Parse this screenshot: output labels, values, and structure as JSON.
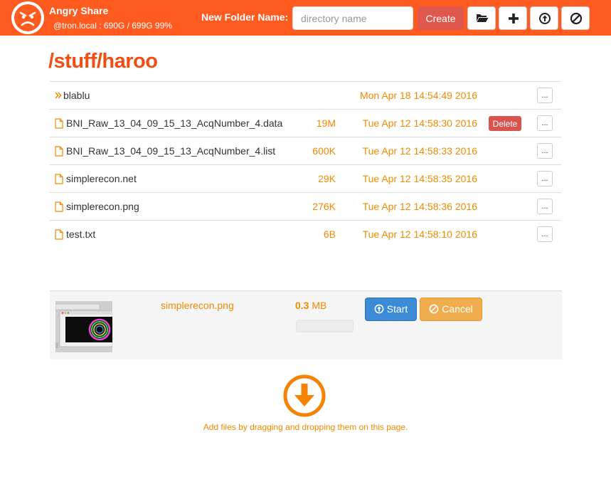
{
  "header": {
    "app_title": "Angry Share",
    "host_info": "@tron.local : 690G / 699G 99%",
    "folder_label": "New Folder Name:",
    "folder_placeholder": "directory name",
    "create_label": "Create",
    "icon_buttons": [
      "open-folder-icon",
      "plus-icon",
      "upload-circle-icon",
      "ban-icon"
    ]
  },
  "path": "/stuff/haroo",
  "files": [
    {
      "type": "directory",
      "icon": "double-chevron-right-icon",
      "name": "blablu",
      "size": "",
      "date": "Mon Apr 18 14:54:49 2016",
      "delete_label": "",
      "more_label": "..."
    },
    {
      "type": "file",
      "icon": "file-icon",
      "name": "BNI_Raw_13_04_09_15_13_AcqNumber_4.data",
      "size": "19M",
      "date": "Tue Apr 12 14:58:30 2016",
      "delete_label": "Delete",
      "more_label": "..."
    },
    {
      "type": "file",
      "icon": "file-icon",
      "name": "BNI_Raw_13_04_09_15_13_AcqNumber_4.list",
      "size": "600K",
      "date": "Tue Apr 12 14:58:33 2016",
      "delete_label": "",
      "more_label": "..."
    },
    {
      "type": "file",
      "icon": "file-icon",
      "name": "simplerecon.net",
      "size": "29K",
      "date": "Tue Apr 12 14:58:35 2016",
      "delete_label": "",
      "more_label": "..."
    },
    {
      "type": "file",
      "icon": "file-icon",
      "name": "simplerecon.png",
      "size": "276K",
      "date": "Tue Apr 12 14:58:36 2016",
      "delete_label": "",
      "more_label": "..."
    },
    {
      "type": "file",
      "icon": "file-icon",
      "name": "test.txt",
      "size": "6B",
      "date": "Tue Apr 12 14:58:10 2016",
      "delete_label": "",
      "more_label": "..."
    }
  ],
  "upload": {
    "file_name": "simplerecon.png",
    "size_value": "0.3",
    "size_unit": "MB",
    "progress": 0,
    "start_label": "Start",
    "cancel_label": "Cancel"
  },
  "dropzone": {
    "icon": "download-circle-icon",
    "text": "Add files by dragging and dropping them on this page."
  },
  "colors": {
    "brand": "#ff5a1f",
    "heading": "#f04e12",
    "accent_text": "#f08a00",
    "delete": "#d9534f",
    "start": "#3c8bd6",
    "cancel": "#f0ad4e"
  }
}
